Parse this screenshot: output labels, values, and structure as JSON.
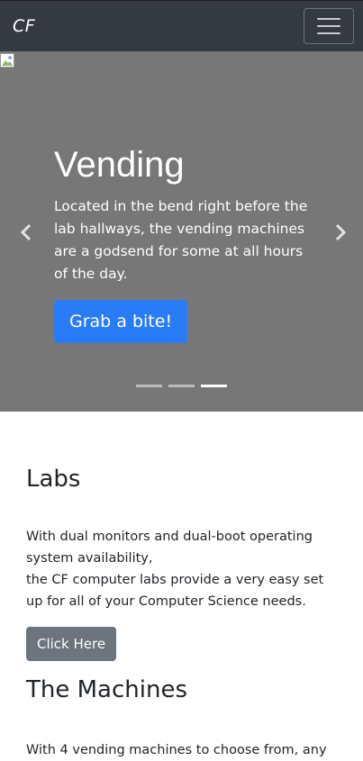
{
  "navbar": {
    "brand": "CF",
    "toggler_icon": "hamburger-icon"
  },
  "carousel": {
    "slide_title": "Vending",
    "slide_text": "Located in the bend right before the lab hallways, the vending machines are a godsend for some at all hours of the day.",
    "button_label": "Grab a bite!",
    "prev_icon": "chevron-left-icon",
    "next_icon": "chevron-right-icon",
    "image_icon": "broken-image-icon",
    "active_slide": 3,
    "slide_count": 3
  },
  "labs": {
    "heading": "Labs",
    "text_line1": "With dual monitors and dual-boot operating system availability,",
    "text_line2": "the CF computer labs provide a very easy set up for all of your Computer Science needs.",
    "button_label": "Click Here"
  },
  "machines": {
    "heading": "The Machines",
    "text": "With 4 vending machines to choose from, any"
  },
  "colors": {
    "navbar_bg": "#343a40",
    "carousel_bg": "#777777",
    "primary": "#2a7cf6",
    "secondary": "#6c757d"
  }
}
